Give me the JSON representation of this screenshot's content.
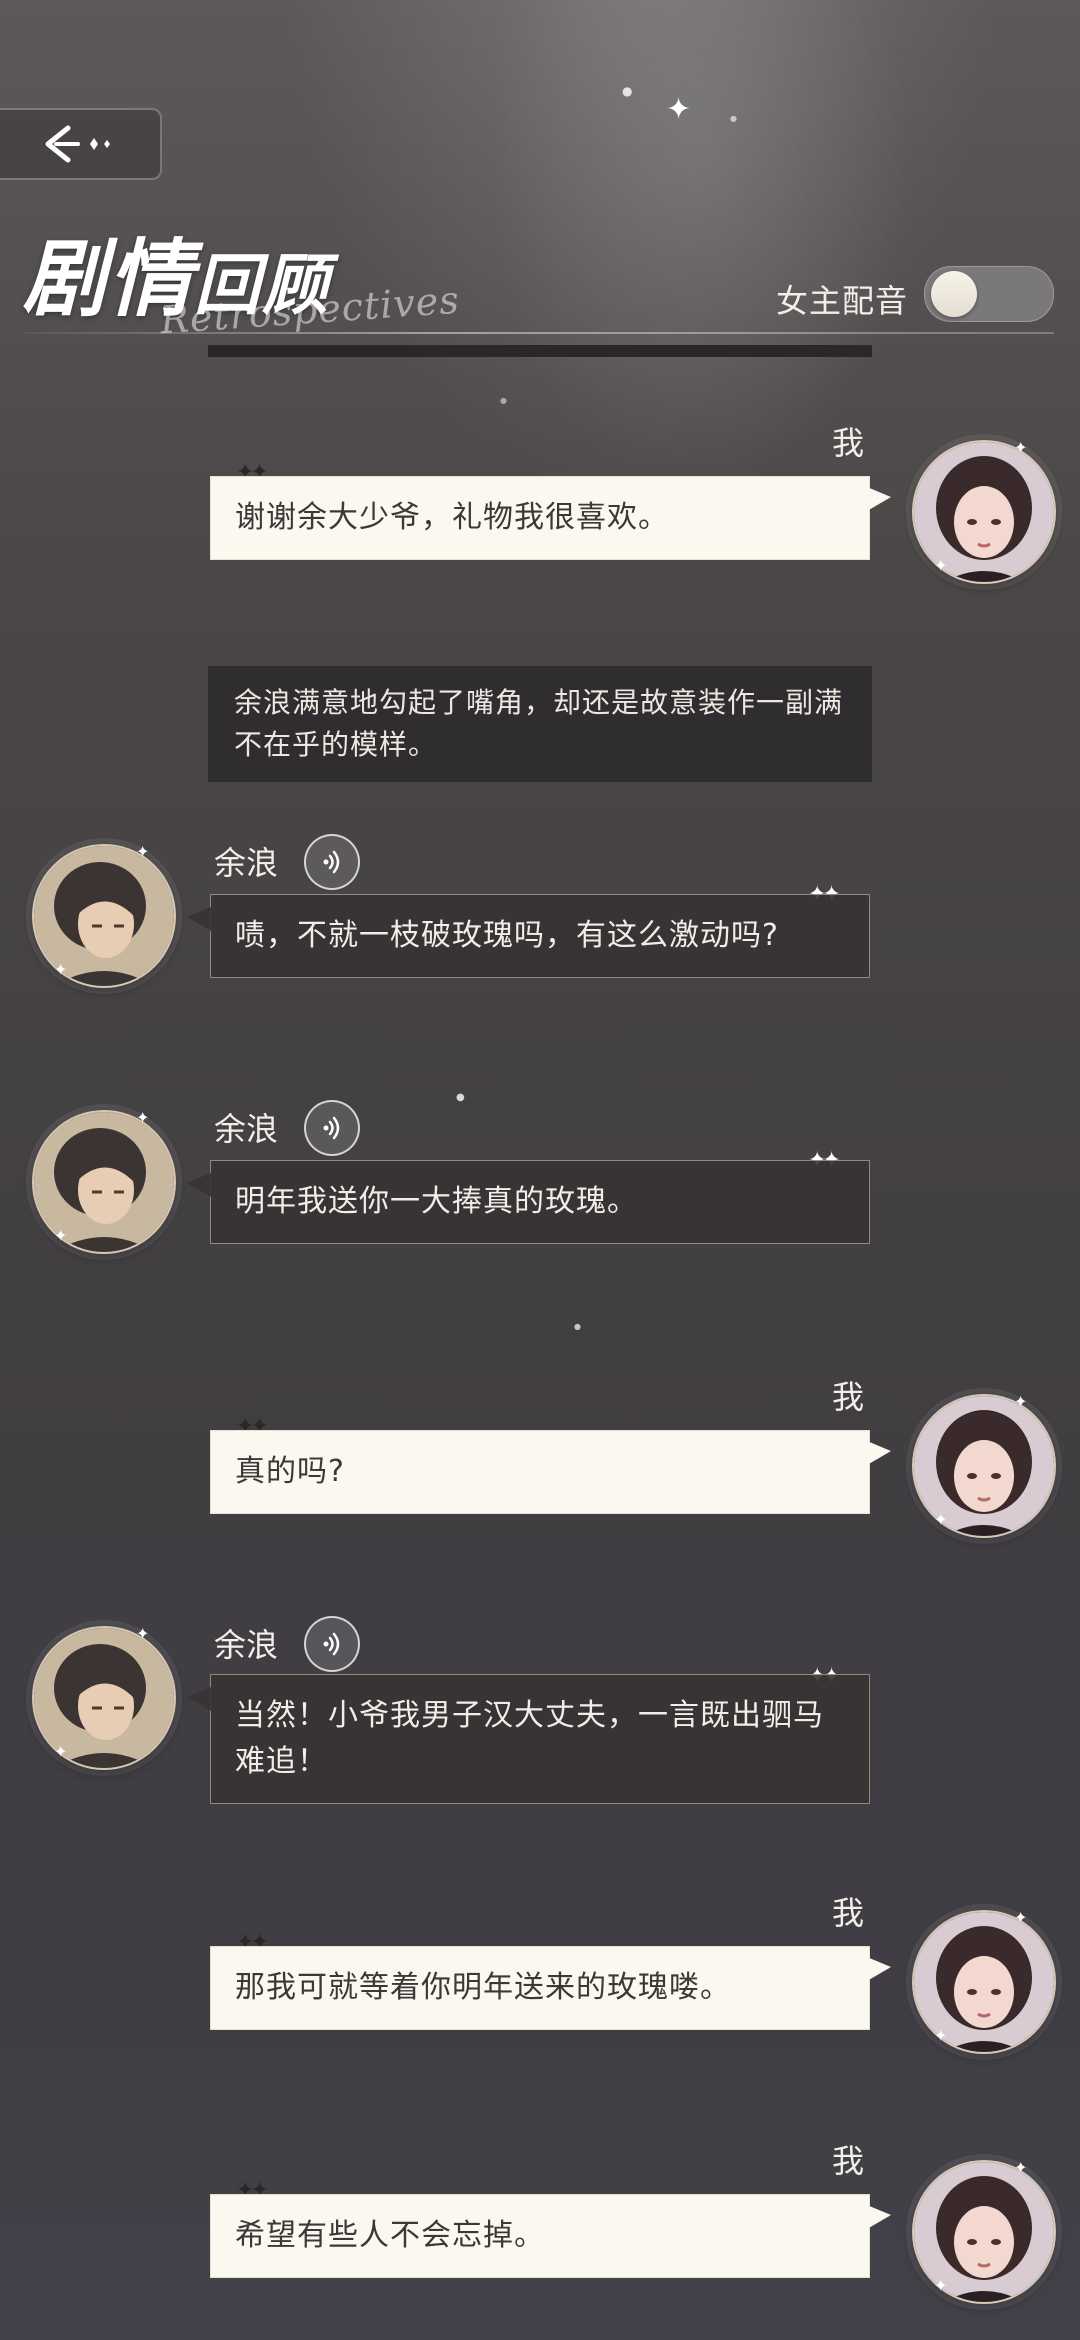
{
  "header": {
    "back_icon": "back-arrow-icon",
    "title_main": "剧情",
    "title_small": "回顾",
    "title_sub": "Retrospectives",
    "voice_toggle_label": "女主配音",
    "voice_toggle_on": false
  },
  "colors": {
    "me_bubble_bg": "#fbf8ef",
    "other_bubble_bg": "#373234",
    "narration_bg": "#2a282a",
    "accent_gold": "#e8dcc4"
  },
  "messages": [
    {
      "type": "me",
      "speaker": "我",
      "text": "谢谢余大少爷，礼物我很喜欢。"
    },
    {
      "type": "narration",
      "text": "余浪满意地勾起了嘴角，却还是故意装作一副满不在乎的模样。"
    },
    {
      "type": "other",
      "speaker": "余浪",
      "text": "啧，不就一枝破玫瑰吗，有这么激动吗?"
    },
    {
      "type": "other",
      "speaker": "余浪",
      "text": "明年我送你一大捧真的玫瑰。"
    },
    {
      "type": "me",
      "speaker": "我",
      "text": "真的吗?"
    },
    {
      "type": "other",
      "speaker": "余浪",
      "text": "当然！小爷我男子汉大丈夫，一言既出驷马难追！"
    },
    {
      "type": "me",
      "speaker": "我",
      "text": "那我可就等着你明年送来的玫瑰喽。"
    },
    {
      "type": "me",
      "speaker": "我",
      "text": "希望有些人不会忘掉。"
    }
  ]
}
